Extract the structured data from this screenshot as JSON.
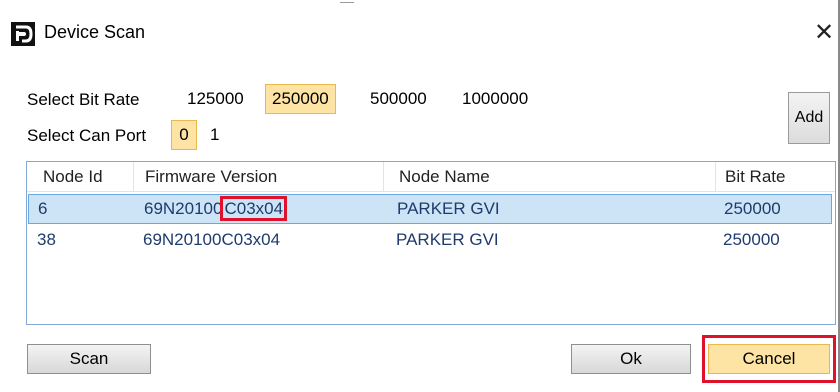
{
  "window": {
    "title": "Device Scan",
    "close_glyph": "✕"
  },
  "bitrate": {
    "label": "Select Bit Rate",
    "options": [
      "125000",
      "250000",
      "500000",
      "1000000"
    ],
    "selected": "250000"
  },
  "canport": {
    "label": "Select Can Port",
    "options": [
      "0",
      "1"
    ],
    "selected": "0"
  },
  "add_label": "Add",
  "table": {
    "columns": [
      "Node Id",
      "Firmware Version",
      "Node Name",
      "Bit Rate"
    ],
    "rows": [
      {
        "node_id": "6",
        "firmware_prefix": "69N20100",
        "firmware_suffix": "C03x04",
        "node_name": "PARKER GVI",
        "bit_rate": "250000"
      },
      {
        "node_id": "38",
        "firmware": "69N20100C03x04",
        "node_name": "PARKER GVI",
        "bit_rate": "250000"
      }
    ]
  },
  "buttons": {
    "scan": "Scan",
    "ok": "Ok",
    "cancel": "Cancel"
  },
  "colors": {
    "selected_option": "#fde3a4",
    "selected_row": "#cde4f7",
    "highlight_box": "#e0112b",
    "row_text": "#1f3b6d"
  }
}
